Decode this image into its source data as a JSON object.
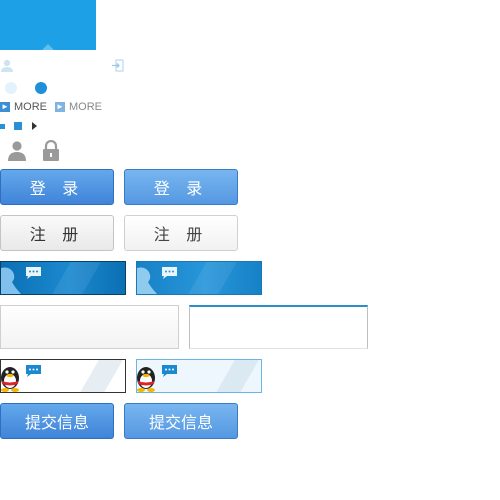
{
  "more_links": [
    {
      "label": "MORE"
    },
    {
      "label": "MORE"
    }
  ],
  "buttons": {
    "login_label": "登 录",
    "login_hover_label": "登 录",
    "register_label": "注 册",
    "register_hover_label": "注 册",
    "submit_label": "提交信息",
    "submit_hover_label": "提交信息"
  },
  "icons": {
    "user": "user-icon",
    "exit": "exit-icon",
    "person": "person-icon",
    "lock": "lock-icon",
    "chat_bubble": "chat-bubble-icon",
    "penguin": "qq-penguin-icon",
    "arrow": "arrow-right-icon"
  },
  "colors": {
    "banner": "#1ea0e6",
    "button_blue": "#3f84d8",
    "qq_bar": "#0c6fb3",
    "input_focus": "#2a8fc9"
  }
}
